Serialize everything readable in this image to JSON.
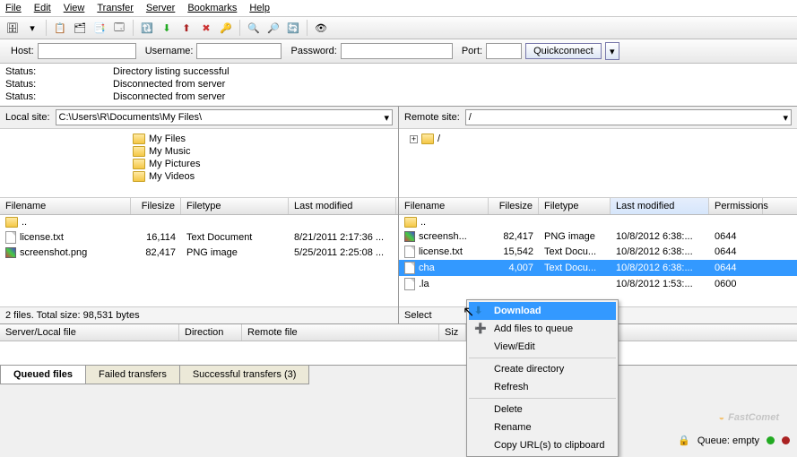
{
  "menu": [
    "File",
    "Edit",
    "View",
    "Transfer",
    "Server",
    "Bookmarks",
    "Help"
  ],
  "quick": {
    "host_lbl": "Host:",
    "user_lbl": "Username:",
    "pass_lbl": "Password:",
    "port_lbl": "Port:",
    "connect": "Quickconnect"
  },
  "log": [
    {
      "k": "Status:",
      "v": "Directory listing successful"
    },
    {
      "k": "Status:",
      "v": "Disconnected from server"
    },
    {
      "k": "Status:",
      "v": "Disconnected from server"
    }
  ],
  "local": {
    "label": "Local site:",
    "path": "C:\\Users\\R\\Documents\\My Files\\",
    "tree": [
      "My Files",
      "My Music",
      "My Pictures",
      "My Videos"
    ],
    "cols": [
      "Filename",
      "Filesize",
      "Filetype",
      "Last modified"
    ],
    "rows": [
      {
        "name": "..",
        "size": "",
        "type": "",
        "mod": "",
        "icon": "folder"
      },
      {
        "name": "license.txt",
        "size": "16,114",
        "type": "Text Document",
        "mod": "8/21/2011 2:17:36 ...",
        "icon": "file"
      },
      {
        "name": "screenshot.png",
        "size": "82,417",
        "type": "PNG image",
        "mod": "5/25/2011 2:25:08 ...",
        "icon": "png"
      }
    ],
    "status": "2 files. Total size: 98,531 bytes"
  },
  "remote": {
    "label": "Remote site:",
    "path": "/",
    "tree_root": "/",
    "cols": [
      "Filename",
      "Filesize",
      "Filetype",
      "Last modified",
      "Permissions"
    ],
    "rows": [
      {
        "name": "..",
        "size": "",
        "type": "",
        "mod": "",
        "perm": "",
        "icon": "folder"
      },
      {
        "name": "screensh...",
        "size": "82,417",
        "type": "PNG image",
        "mod": "10/8/2012 6:38:...",
        "perm": "0644",
        "icon": "png"
      },
      {
        "name": "license.txt",
        "size": "15,542",
        "type": "Text Docu...",
        "mod": "10/8/2012 6:38:...",
        "perm": "0644",
        "icon": "file"
      },
      {
        "name": "cha",
        "size": "4,007",
        "type": "Text Docu...",
        "mod": "10/8/2012 6:38:...",
        "perm": "0644",
        "icon": "file",
        "selected": true
      },
      {
        "name": ".la",
        "size": "",
        "type": "",
        "mod": "10/8/2012 1:53:...",
        "perm": "0600",
        "icon": "file"
      }
    ],
    "status": "Select"
  },
  "queue": {
    "cols": [
      "Server/Local file",
      "Direction",
      "Remote file",
      "Siz"
    ],
    "tabs": [
      "Queued files",
      "Failed transfers",
      "Successful transfers (3)"
    ]
  },
  "context": {
    "items": [
      {
        "t": "Download",
        "bold": true,
        "hl": true,
        "icon": "down"
      },
      {
        "t": "Add files to queue",
        "icon": "add"
      },
      {
        "t": "View/Edit"
      },
      {
        "sep": true
      },
      {
        "t": "Create directory"
      },
      {
        "t": "Refresh"
      },
      {
        "sep": true
      },
      {
        "t": "Delete"
      },
      {
        "t": "Rename"
      },
      {
        "t": "Copy URL(s) to clipboard"
      }
    ]
  },
  "bottom": {
    "queue": "Queue: empty"
  },
  "watermark": "FastComet"
}
